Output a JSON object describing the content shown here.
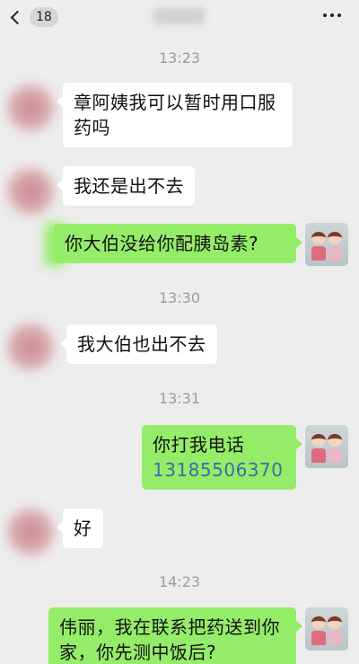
{
  "header": {
    "back_badge": "18",
    "title": ""
  },
  "messages": [
    {
      "type": "time",
      "text": "13:23"
    },
    {
      "type": "incoming",
      "text": "章阿姨我可以暂时用口服药吗"
    },
    {
      "type": "incoming",
      "text": "我还是出不去"
    },
    {
      "type": "outgoing",
      "text": "你大伯没给你配胰岛素?"
    },
    {
      "type": "time",
      "text": "13:30"
    },
    {
      "type": "incoming",
      "text": "我大伯也出不去"
    },
    {
      "type": "time",
      "text": "13:31"
    },
    {
      "type": "outgoing",
      "text": "你打我电话",
      "phone": "13185506370"
    },
    {
      "type": "incoming",
      "text": "好"
    },
    {
      "type": "time",
      "text": "14:23"
    },
    {
      "type": "outgoing",
      "text": "伟丽，我在联系把药送到你家，你先测中饭后?"
    }
  ],
  "colors": {
    "background": "#ededed",
    "bubble_incoming": "#ffffff",
    "bubble_outgoing": "#95ec69",
    "link": "#3a6ea5",
    "timestamp": "#9b9b9b"
  },
  "icons": {
    "back": "chevron-left-icon",
    "more": "more-dots-icon"
  }
}
